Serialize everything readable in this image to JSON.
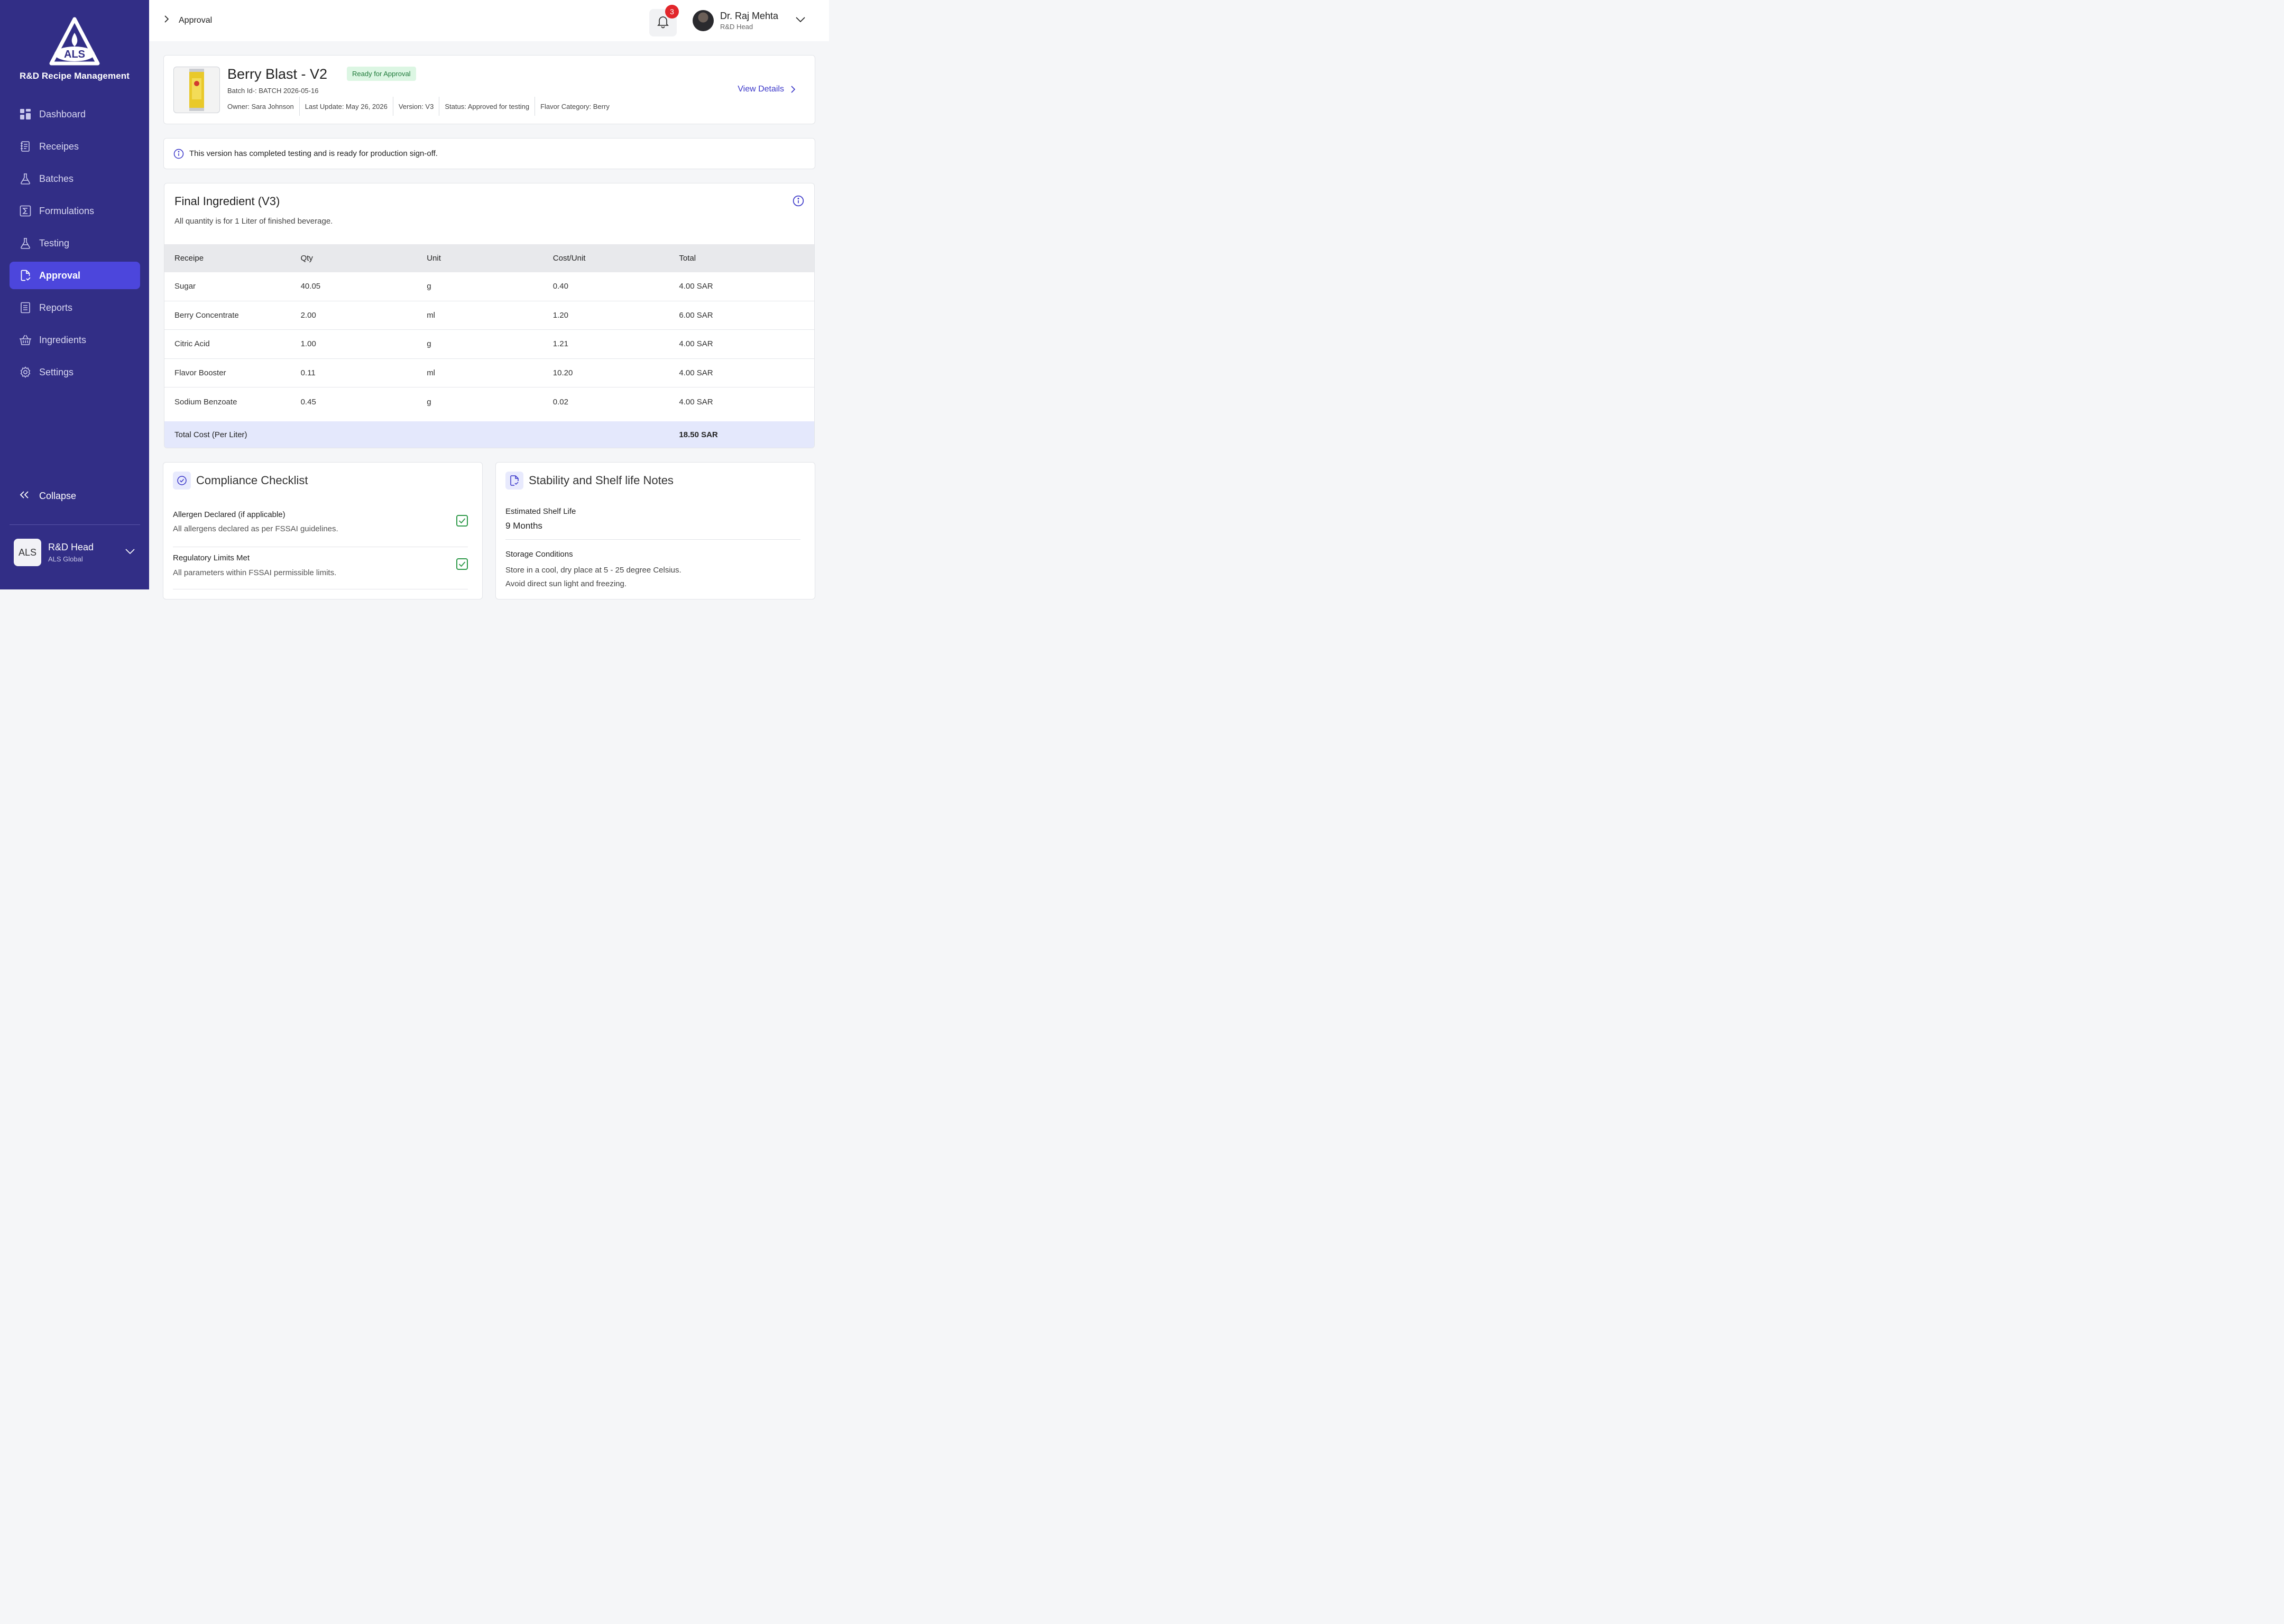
{
  "sidebar": {
    "logo_text": "ALS",
    "app_title": "R&D Recipe Management",
    "items": [
      {
        "label": "Dashboard",
        "icon": "dashboard-icon",
        "active": false
      },
      {
        "label": "Receipes",
        "icon": "recipes-icon",
        "active": false
      },
      {
        "label": "Batches",
        "icon": "flask-icon",
        "active": false
      },
      {
        "label": "Formulations",
        "icon": "sigma-icon",
        "active": false
      },
      {
        "label": "Testing",
        "icon": "flask-icon",
        "active": false
      },
      {
        "label": "Approval",
        "icon": "approval-document-icon",
        "active": true
      },
      {
        "label": "Reports",
        "icon": "report-icon",
        "active": false
      },
      {
        "label": "Ingredients",
        "icon": "basket-icon",
        "active": false
      },
      {
        "label": "Settings",
        "icon": "gear-icon",
        "active": false
      }
    ],
    "collapse_label": "Collapse",
    "org": {
      "badge": "ALS",
      "name": "R&D Head",
      "sub": "ALS Global"
    }
  },
  "header": {
    "breadcrumb": "Approval",
    "notification_count": "3",
    "user": {
      "name": "Dr. Raj Mehta",
      "role": "R&D Head"
    }
  },
  "product": {
    "title": "Berry Blast - V2",
    "status_badge": "Ready for Approval",
    "batch": "Batch Id-: BATCH 2026-05-16",
    "meta": {
      "owner": "Owner: Sara Johnson",
      "last_update": "Last Update: May 26, 2026",
      "version": "Version: V3",
      "status": "Status: Approved for testing",
      "flavor": "Flavor Category: Berry"
    },
    "view_details": "View Details"
  },
  "notice": "This version has completed testing and is ready for production sign-off.",
  "ingredients": {
    "title": "Final Ingredient (V3)",
    "subtitle": "All quantity is for 1 Liter of finished beverage.",
    "columns": [
      "Receipe",
      "Qty",
      "Unit",
      "Cost/Unit",
      "Total"
    ],
    "rows": [
      [
        "Sugar",
        "40.05",
        "g",
        "0.40",
        "4.00 SAR"
      ],
      [
        "Berry Concentrate",
        "2.00",
        "ml",
        "1.20",
        "6.00 SAR"
      ],
      [
        "Citric Acid",
        "1.00",
        "g",
        "1.21",
        "4.00 SAR"
      ],
      [
        "Flavor Booster",
        "0.11",
        "ml",
        "10.20",
        "4.00 SAR"
      ],
      [
        "Sodium Benzoate",
        "0.45",
        "g",
        "0.02",
        "4.00 SAR"
      ]
    ],
    "total_label": "Total Cost (Per Liter)",
    "total_value": "18.50 SAR"
  },
  "compliance": {
    "title": "Compliance Checklist",
    "items": [
      {
        "title": "Allergen Declared (if applicable)",
        "desc": "All allergens declared as per FSSAI guidelines.",
        "checked": true
      },
      {
        "title": "Regulatory Limits Met",
        "desc": "All parameters within FSSAI permissible limits.",
        "checked": true
      }
    ]
  },
  "stability": {
    "title": "Stability and Shelf life Notes",
    "shelf_label": "Estimated Shelf Life",
    "shelf_value": "9 Months",
    "storage_label": "Storage Conditions",
    "storage_line1": "Store in a cool, dry place at 5 - 25 degree Celsius.",
    "storage_line2": "Avoid direct sun light and freezing."
  },
  "colors": {
    "sidebar_bg": "#322e86",
    "active_nav": "#4c46dc",
    "accent": "#3b37c9",
    "success": "#2f9a4a",
    "notification": "#e2262b",
    "ready_badge_bg": "#dcf6e3"
  }
}
